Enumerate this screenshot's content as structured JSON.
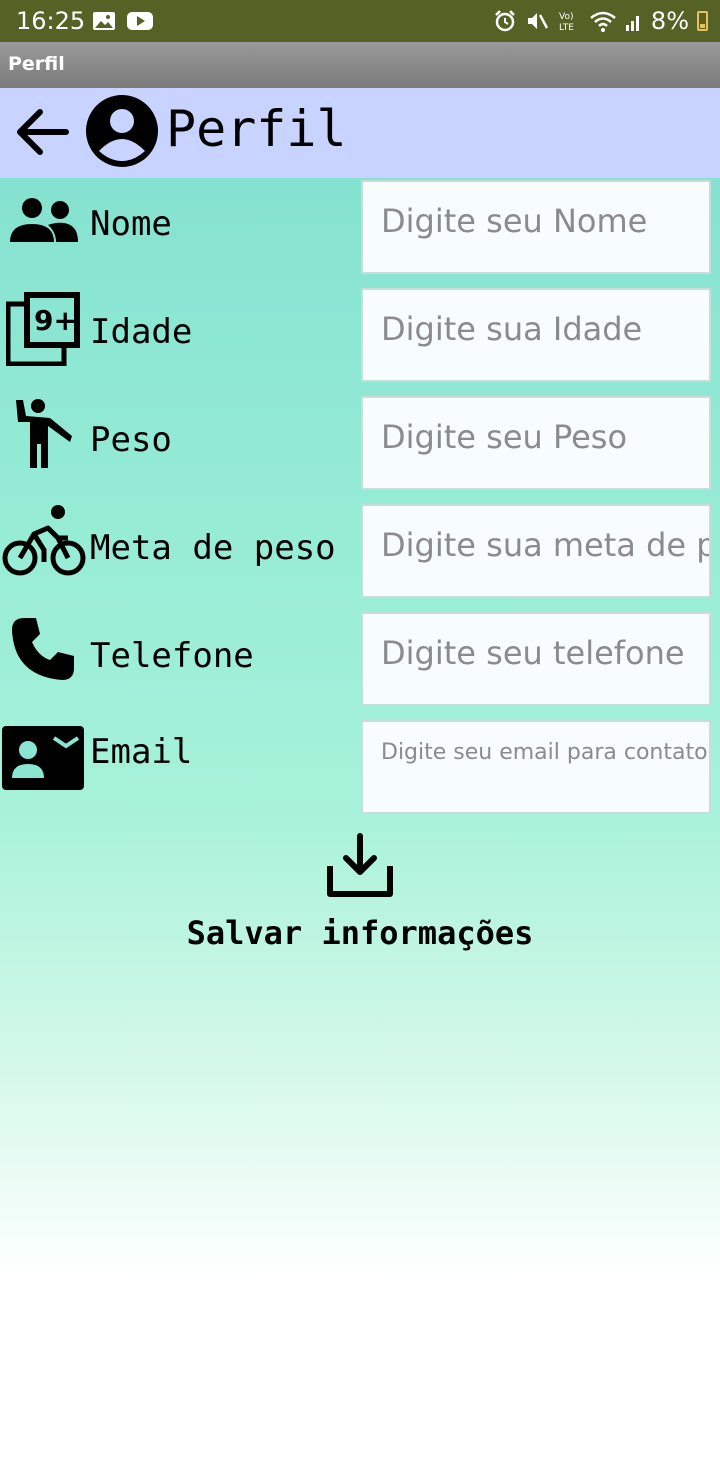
{
  "status_bar": {
    "time": "16:25",
    "battery": "8%",
    "icons": [
      "image-icon",
      "youtube-icon",
      "alarm-icon",
      "mute-icon",
      "volte-icon",
      "wifi-icon",
      "signal-icon",
      "battery-icon"
    ]
  },
  "app_titlebar": {
    "title": "Perfil"
  },
  "header": {
    "title": "Perfil"
  },
  "form": {
    "rows": [
      {
        "label": "Nome",
        "placeholder": "Digite seu Nome",
        "icon": "people-icon"
      },
      {
        "label": "Idade",
        "placeholder": "Digite sua Idade",
        "icon": "age-9plus-icon"
      },
      {
        "label": "Peso",
        "placeholder": "Digite seu Peso",
        "icon": "person-waving-icon"
      },
      {
        "label": "Meta de peso",
        "placeholder": "Digite sua meta de peso",
        "icon": "bicycle-icon"
      },
      {
        "label": "Telefone",
        "placeholder": "Digite seu telefone",
        "icon": "phone-icon"
      },
      {
        "label": "Email",
        "placeholder": "Digite seu email para contato",
        "icon": "contact-mail-icon"
      }
    ]
  },
  "save": {
    "label": "Salvar informações",
    "icon": "download-icon"
  }
}
